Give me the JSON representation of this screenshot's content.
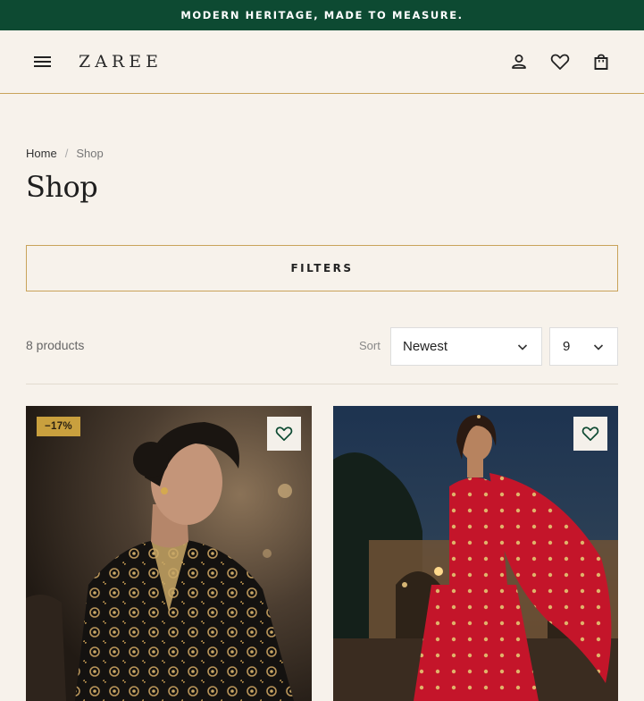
{
  "announcement": "MODERN HERITAGE, MADE TO MEASURE.",
  "header": {
    "logo": "ZAREE",
    "icons": [
      "menu-icon",
      "account-icon",
      "heart-icon",
      "bag-icon"
    ]
  },
  "breadcrumb": {
    "home": "Home",
    "separator": "/",
    "current": "Shop"
  },
  "page_title": "Shop",
  "filters_label": "FILTERS",
  "toolbar": {
    "count": "8 products",
    "sort_label": "Sort",
    "sort_value": "Newest",
    "per_page_value": "9"
  },
  "products": [
    {
      "badge": "−17%",
      "wishlist_icon": "heart-icon"
    },
    {
      "wishlist_icon": "heart-icon"
    }
  ],
  "colors": {
    "announcement_bg": "#0d4a32",
    "page_bg": "#f7f2eb",
    "accent_gold": "#c9a35a",
    "badge_bg": "#c9a03e",
    "heart_green": "#0d4a32"
  }
}
